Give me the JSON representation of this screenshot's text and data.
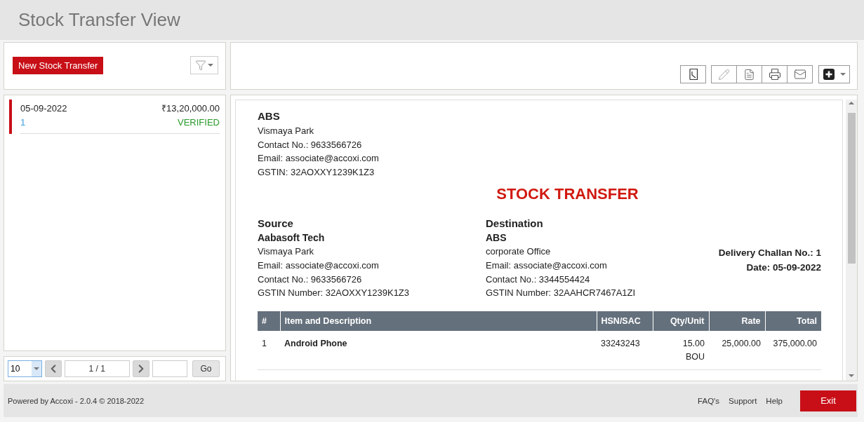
{
  "header": {
    "title": "Stock Transfer View"
  },
  "sidebar": {
    "new_button": "New Stock Transfer",
    "items": [
      {
        "date": "05-09-2022",
        "amount": "₹13,20,000.00",
        "number": "1",
        "status": "VERIFIED",
        "selected": true
      }
    ],
    "pager": {
      "page_size": "10",
      "page": "1 / 1",
      "go": "Go"
    }
  },
  "document": {
    "company": {
      "name": "ABS",
      "lines": [
        "Vismaya Park",
        "Contact No.: 9633566726",
        "Email: associate@accoxi.com",
        "GSTIN: 32AOXXY1239K1Z3"
      ]
    },
    "title": "STOCK TRANSFER",
    "parties": [
      {
        "heading": "Source",
        "name": "Aabasoft Tech",
        "lines": [
          "Vismaya Park",
          "Email: associate@accoxi.com",
          "Contact No.: 9633566726",
          "GSTIN Number: 32AOXXY1239K1Z3"
        ]
      },
      {
        "heading": "Destination",
        "name": "ABS",
        "lines": [
          "corporate Office",
          "Email: associate@accoxi.com",
          "Contact No.: 3344554424",
          "GSTIN Number: 32AAHCR7467A1ZI"
        ]
      }
    ],
    "challan": [
      "Delivery Challan No.: 1",
      "Date: 05-09-2022"
    ],
    "table": {
      "columns": [
        "#",
        "Item and Description",
        "HSN/SAC",
        "Qty/Unit",
        "Rate",
        "Total"
      ],
      "rows": [
        {
          "index": "1",
          "item": "Android Phone",
          "hsn": "33243243",
          "qty": "15.00",
          "unit": "BOU",
          "rate": "25,000.00",
          "total": "375,000.00"
        }
      ]
    }
  },
  "footer": {
    "powered": "Powered by Accoxi - 2.0.4 © 2018-2022",
    "links": [
      "FAQ's",
      "Support",
      "Help"
    ],
    "exit": "Exit"
  }
}
